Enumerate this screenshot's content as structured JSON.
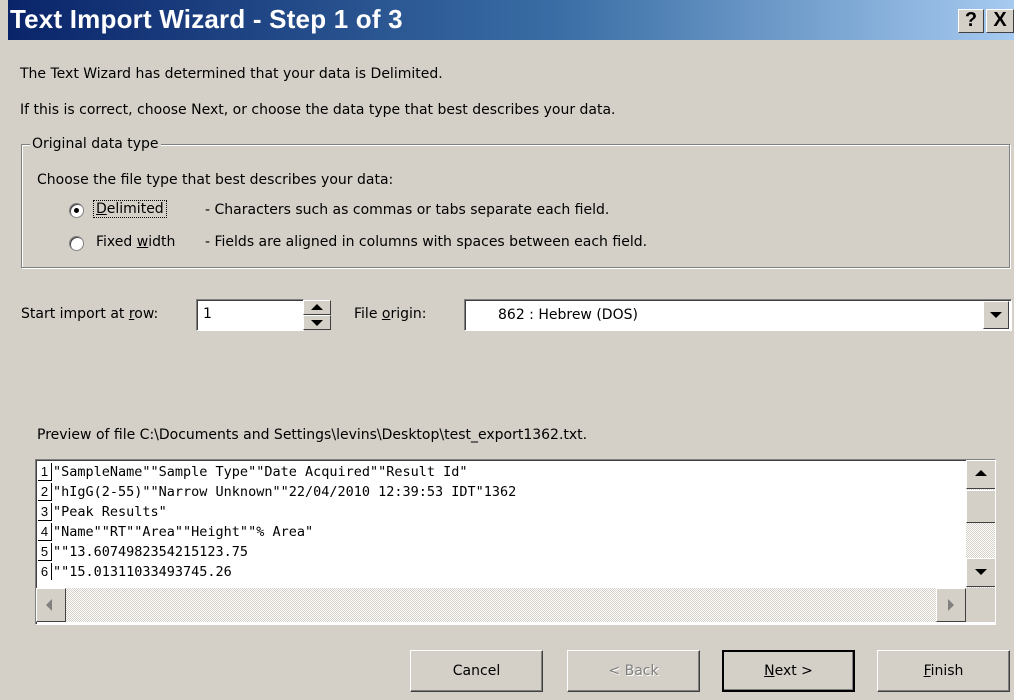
{
  "dialog": {
    "title": "Text Import Wizard - Step 1 of 3",
    "help_button": "?",
    "close_button": "X"
  },
  "intro": {
    "line1": "The Text Wizard has determined that your data is Delimited.",
    "line2": "If this is correct, choose Next, or choose the data type that best describes your data."
  },
  "original_data_type": {
    "group_label": "Original data type",
    "prompt": "Choose the file type that best describes your data:",
    "options": [
      {
        "label_mnemonic": "D",
        "label_rest": "elimited",
        "description": "- Characters such as commas or tabs separate each field.",
        "selected": true
      },
      {
        "label_prefix": "Fixed ",
        "label_mnemonic": "w",
        "label_rest": "idth",
        "description": "- Fields are aligned in columns with spaces between each field.",
        "selected": false
      }
    ]
  },
  "start_row": {
    "label_prefix": "Start import at ",
    "label_mnemonic": "r",
    "label_rest": "ow:",
    "value": "1"
  },
  "file_origin": {
    "label_prefix": "File ",
    "label_mnemonic": "o",
    "label_rest": "rigin:",
    "value": "862 : Hebrew (DOS)"
  },
  "preview": {
    "label": "Preview of file C:\\Documents and Settings\\levins\\Desktop\\test_export1362.txt.",
    "rows": [
      {
        "num": "1",
        "text": "\"SampleName\"\"Sample Type\"\"Date Acquired\"\"Result Id\""
      },
      {
        "num": "2",
        "text": "\"hIgG(2-55)\"\"Narrow Unknown\"\"22/04/2010 12:39:53 IDT\"1362"
      },
      {
        "num": "3",
        "text": "\"Peak Results\""
      },
      {
        "num": "4",
        "text": "\"Name\"\"RT\"\"Area\"\"Height\"\"% Area\""
      },
      {
        "num": "5",
        "text": "\"\"13.6074982354215123.75"
      },
      {
        "num": "6",
        "text": "\"\"15.01311033493745.26"
      }
    ]
  },
  "buttons": {
    "cancel": "Cancel",
    "back": "< Back",
    "next_mnemonic": "N",
    "next_rest": "ext >",
    "finish_mnemonic": "F",
    "finish_rest": "inish"
  }
}
